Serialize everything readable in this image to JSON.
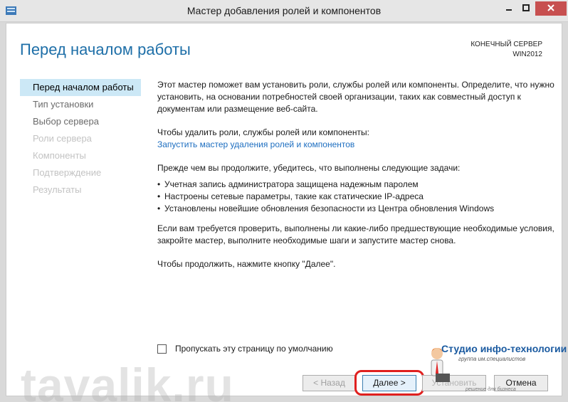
{
  "window": {
    "title": "Мастер добавления ролей и компонентов"
  },
  "header": {
    "page_title": "Перед началом работы",
    "server_label": "КОНЕЧНЫЙ СЕРВЕР",
    "server_name": "WIN2012"
  },
  "nav": {
    "items": [
      {
        "label": "Перед началом работы",
        "state": "active"
      },
      {
        "label": "Тип установки",
        "state": "enabled"
      },
      {
        "label": "Выбор сервера",
        "state": "enabled"
      },
      {
        "label": "Роли сервера",
        "state": "disabled"
      },
      {
        "label": "Компоненты",
        "state": "disabled"
      },
      {
        "label": "Подтверждение",
        "state": "disabled"
      },
      {
        "label": "Результаты",
        "state": "disabled"
      }
    ]
  },
  "main": {
    "intro": "Этот мастер поможет вам установить роли, службы ролей или компоненты. Определите, что нужно установить, на основании потребностей своей организации, таких как совместный доступ к документам или размещение веб-сайта.",
    "remove_text": "Чтобы удалить роли, службы ролей или компоненты:",
    "remove_link": "Запустить мастер удаления ролей и компонентов",
    "prereq_text": "Прежде чем вы продолжите, убедитесь, что выполнены следующие задачи:",
    "tasks": [
      "Учетная запись администратора защищена надежным паролем",
      "Настроены сетевые параметры, такие как статические IP-адреса",
      "Установлены новейшие обновления безопасности из Центра обновления Windows"
    ],
    "verify_text": "Если вам требуется проверить, выполнены ли какие-либо предшествующие необходимые условия, закройте мастер, выполните необходимые шаги и запустите мастер снова.",
    "continue_text": "Чтобы продолжить, нажмите кнопку \"Далее\".",
    "skip_label": "Пропускать эту страницу по умолчанию",
    "skip_checked": false
  },
  "buttons": {
    "back": "< Назад",
    "next": "Далее >",
    "install": "Установить",
    "cancel": "Отмена"
  },
  "overlay": {
    "watermark": "tavalik.ru",
    "studio_name": "Студио инфо-технологии",
    "studio_sub": "группа им.специалистов",
    "studio_sub2": "решение для бизнеса"
  },
  "colors": {
    "accent": "#1e6fa8",
    "nav_active_bg": "#cce8f6",
    "link": "#1d6ec0",
    "close_button": "#c75050",
    "highlight_ring": "#e0201f"
  }
}
